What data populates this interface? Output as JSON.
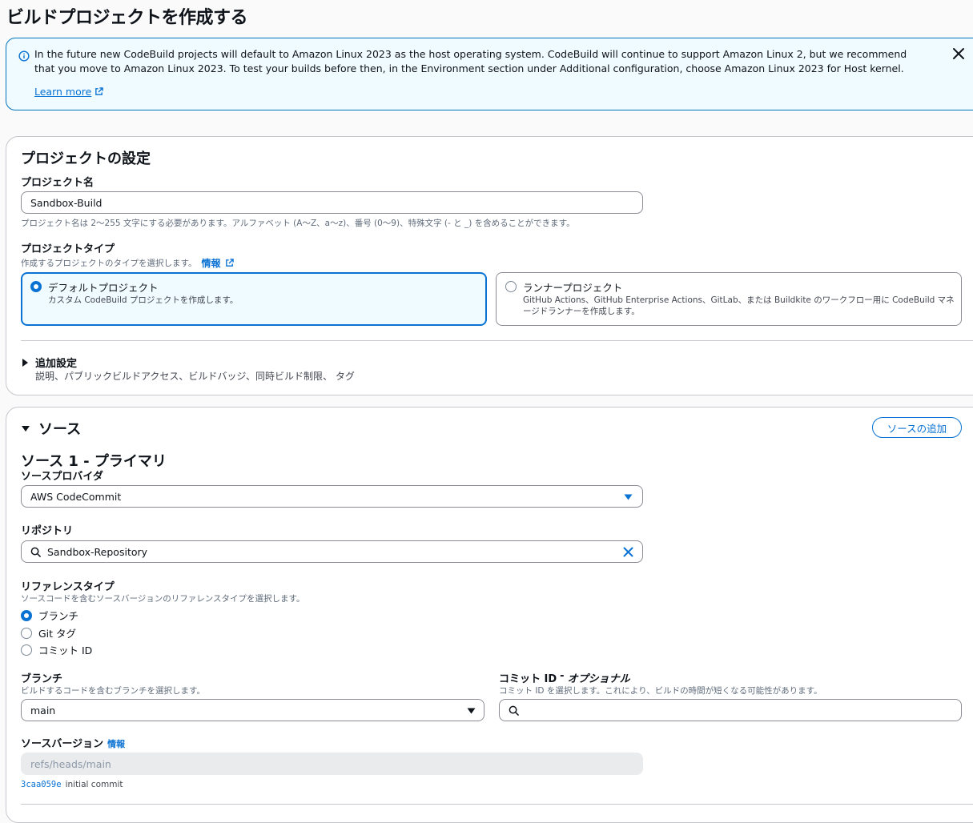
{
  "page_title": "ビルドプロジェクトを作成する",
  "flash": {
    "message": "In the future new CodeBuild projects will default to Amazon Linux 2023 as the host operating system. CodeBuild will continue to support Amazon Linux 2, but we recommend that you move to Amazon Linux 2023. To test your builds before then, in the Environment section under Additional configuration, choose Amazon Linux 2023 for Host kernel.",
    "learn_more": "Learn more",
    "color": "#0972d3"
  },
  "project_settings": {
    "heading": "プロジェクトの設定",
    "name_label": "プロジェクト名",
    "name_value": "Sandbox-Build",
    "name_hint": "プロジェクト名は 2〜255 文字にする必要があります。アルファベット (A〜Z、a〜z)、番号 (0〜9)、特殊文字 (- と _) を含めることができます。",
    "type_label": "プロジェクトタイプ",
    "type_desc": "作成するプロジェクトのタイプを選択します。",
    "type_info": "情報",
    "tiles": [
      {
        "title": "デフォルトプロジェクト",
        "desc": "カスタム CodeBuild プロジェクトを作成します。",
        "selected": true
      },
      {
        "title": "ランナープロジェクト",
        "desc": "GitHub Actions、GitHub Enterprise Actions、GitLab、または Buildkite のワークフロー用に CodeBuild マネージドランナーを作成します。",
        "selected": false
      }
    ],
    "additional_title": "追加設定",
    "additional_desc": "説明、パブリックビルドアクセス、ビルドバッジ、同時ビルド制限、 タグ"
  },
  "source": {
    "heading": "ソース",
    "add_button": "ソースの追加",
    "sub_heading": "ソース 1 - プライマリ",
    "provider_label": "ソースプロバイダ",
    "provider_value": "AWS CodeCommit",
    "repo_label": "リポジトリ",
    "repo_value": "Sandbox-Repository",
    "ref_label": "リファレンスタイプ",
    "ref_desc": "ソースコードを含むソースバージョンのリファレンスタイプを選択します。",
    "ref_options": [
      {
        "label": "ブランチ",
        "selected": true
      },
      {
        "label": "Git タグ",
        "selected": false
      },
      {
        "label": "コミット ID",
        "selected": false
      }
    ],
    "branch_label": "ブランチ",
    "branch_desc": "ビルドするコードを含むブランチを選択します。",
    "branch_value": "main",
    "commit_label": "コミット ID",
    "commit_optional": "オプショナル",
    "commit_desc": "コミット ID を選択します。これにより、ビルドの時間が短くなる可能性があります。",
    "version_label": "ソースバージョン",
    "version_info": "情報",
    "version_value": "refs/heads/main",
    "commit_hash": "3caa059e",
    "commit_msg": "initial commit"
  }
}
